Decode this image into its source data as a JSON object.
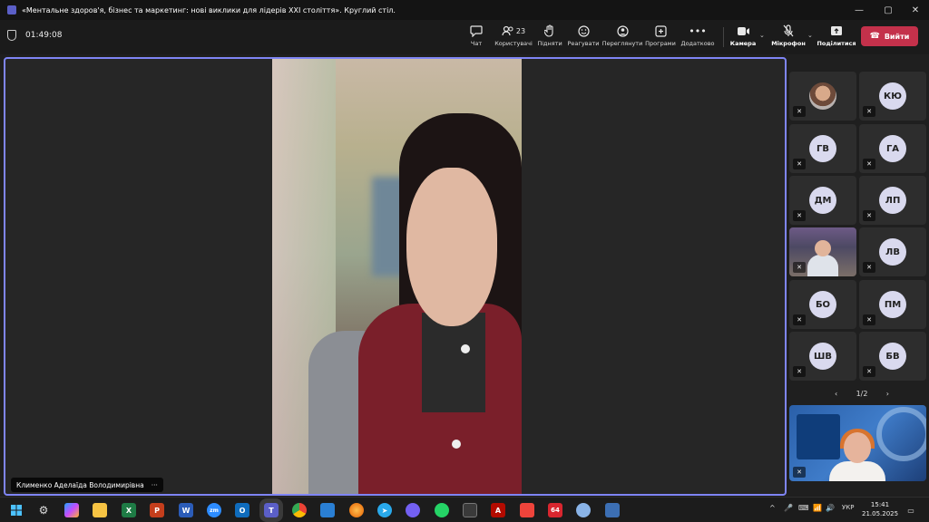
{
  "window": {
    "title": "«Ментальне здоров'я, бізнес та маркетинг: нові виклики для лідерів XXI століття». Круглий стіл.",
    "minimize": "—",
    "maximize": "▢",
    "close": "✕"
  },
  "toolbar": {
    "timer": "01:49:08",
    "chat": "Чат",
    "people": "Користувачі",
    "people_count": "23",
    "raise": "Підняти",
    "react": "Реагувати",
    "view": "Переглянути",
    "apps": "Програми",
    "more": "Додатково",
    "camera": "Камера",
    "mic": "Мікрофон",
    "share": "Поділитися",
    "leave": "Вийти"
  },
  "stage": {
    "speaker_name": "Клименко Аделаїда Володимирівна",
    "more": "···"
  },
  "participants": [
    {
      "initials": "",
      "photo": true
    },
    {
      "initials": "КЮ"
    },
    {
      "initials": "ГВ"
    },
    {
      "initials": "ГА"
    },
    {
      "initials": "ДМ"
    },
    {
      "initials": "ЛП"
    },
    {
      "initials": "",
      "camera": true
    },
    {
      "initials": "ЛВ"
    },
    {
      "initials": "БО"
    },
    {
      "initials": "ПМ"
    },
    {
      "initials": "ШВ"
    },
    {
      "initials": "БВ"
    }
  ],
  "pager": {
    "prev": "‹",
    "label": "1/2",
    "next": "›"
  },
  "taskbar": {
    "apps": [
      "start",
      "settings",
      "copilot",
      "file-explorer",
      "excel",
      "powerpoint",
      "word",
      "zoom",
      "outlook",
      "teams",
      "chrome",
      "app",
      "firefox",
      "telegram",
      "viber",
      "whatsapp",
      "calculator",
      "acrobat",
      "anydesk",
      "cpu-z",
      "paint",
      "save"
    ],
    "tray_icons": [
      "^",
      "🎤",
      "⌨",
      "📶",
      "🔊",
      "🔋"
    ],
    "language": "УКР",
    "time": "15:41",
    "date": "21.05.2025"
  }
}
